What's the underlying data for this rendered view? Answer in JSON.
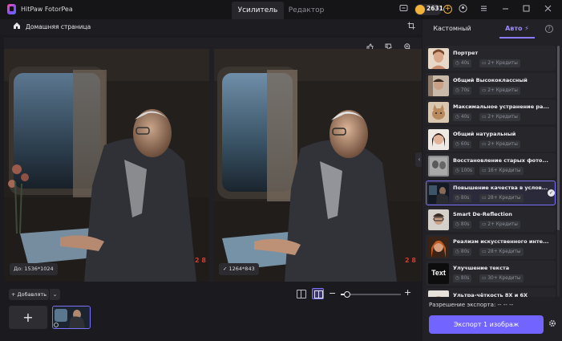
{
  "app": {
    "title": "HitPaw FotorPea"
  },
  "tabs": [
    {
      "label": "Усилитель",
      "active": true
    },
    {
      "label": "Редактор",
      "active": false
    }
  ],
  "titlebar": {
    "credits": "2631",
    "icons": [
      "feedback-icon",
      "coin-icon",
      "add-credits-icon",
      "account-icon",
      "menu-icon",
      "minimize-icon",
      "maximize-icon",
      "close-icon"
    ]
  },
  "toolbar": {
    "home_label": "Домашняя страница"
  },
  "viewer": {
    "before_label": "До: 1536*1024",
    "after_label": "1264*843",
    "time_mark": "2 8",
    "icons": [
      "thumbs-up-icon",
      "thumbs-down-icon",
      "zoom-icon",
      "crop-icon"
    ]
  },
  "bottom": {
    "add_label": "+ Добавлять",
    "add_tile": "+",
    "zoom_percent": 10
  },
  "panel": {
    "tab_custom": "Кастомный",
    "tab_auto": "Авто",
    "models": [
      {
        "name": "Портрет",
        "time": "40s",
        "credits": "2+ Кредиты",
        "thumb": "portrait"
      },
      {
        "name": "Общий Высококлассный",
        "time": "70s",
        "credits": "2+ Кредиты",
        "thumb": "general-hq"
      },
      {
        "name": "Максимальное устранение ра...",
        "time": "40s",
        "credits": "2+ Кредиты",
        "thumb": "cat"
      },
      {
        "name": "Общий натуральный",
        "time": "60s",
        "credits": "2+ Кредиты",
        "thumb": "natural"
      },
      {
        "name": "Восстановление старых фото...",
        "time": "100s",
        "credits": "16+ Кредиты",
        "thumb": "old-photo"
      },
      {
        "name": "Повышение качества в услов...",
        "time": "80s",
        "credits": "28+ Кредиты",
        "thumb": "lowlight",
        "selected": true
      },
      {
        "name": "Smart De-Reflection",
        "time": "80s",
        "credits": "2+ Кредиты",
        "thumb": "dereflect"
      },
      {
        "name": "Реализм искусственного инте...",
        "time": "80s",
        "credits": "28+ Кредиты",
        "thumb": "ai-realism"
      },
      {
        "name": "Улучшение текста",
        "time": "80s",
        "credits": "30+ Кредиты",
        "thumb": "text",
        "thumb_text": "Text"
      },
      {
        "name": "Ультра-чёткость 8X и 6X",
        "time": "",
        "credits": "",
        "thumb": "ultra"
      }
    ],
    "export_res": "Разрешение экспорта: -- -- --",
    "export_button": "Экспорт 1 изображ"
  },
  "colors": {
    "accent": "#7264ff",
    "accent_text": "#9c8bff",
    "credits_coin": "#f0b43a",
    "time_mark": "#d83a2c"
  }
}
